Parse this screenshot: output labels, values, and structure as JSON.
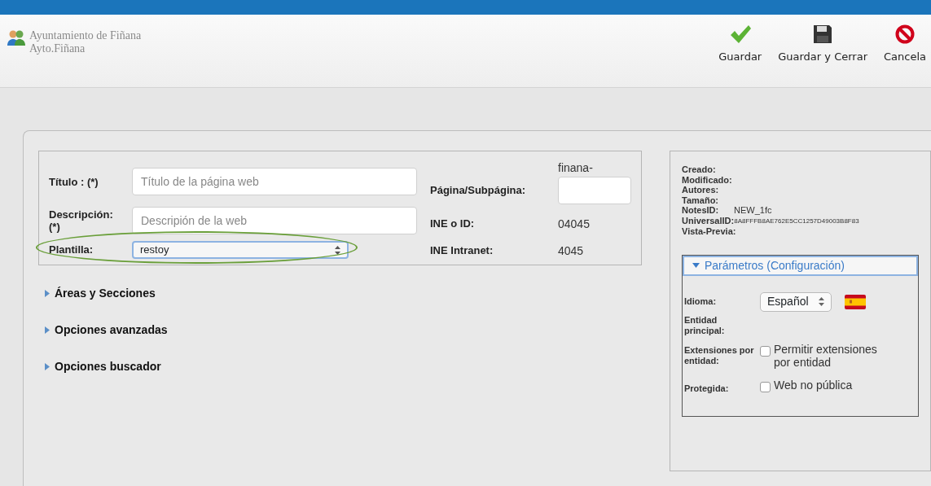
{
  "header": {
    "org_name": "Ayuntamiento de Fiñana",
    "org_short": "Ayto.Fiñana"
  },
  "toolbar": [
    {
      "kind": "save",
      "label": "Guardar"
    },
    {
      "kind": "save-close",
      "label": "Guardar y Cerrar"
    },
    {
      "kind": "cancel",
      "label": "Cancela"
    }
  ],
  "form": {
    "title_field": {
      "label": "Título : (*)",
      "placeholder": "Título de la página web"
    },
    "description_field": {
      "label": "Descripción: (*)",
      "placeholder": "Descripión de la web"
    },
    "template_field": {
      "label": "Plantilla:",
      "value": "restoy",
      "highlighted": true
    },
    "page_field": {
      "label": "Página/Subpágina:",
      "prefix": "finana-"
    },
    "ine_id": {
      "label": "INE o ID:",
      "value": "04045"
    },
    "ine_intranet": {
      "label": "INE Intranet:",
      "value": "4045"
    }
  },
  "sections": [
    {
      "label": "Áreas y Secciones",
      "expanded": false
    },
    {
      "label": "Opciones avanzadas",
      "expanded": false
    },
    {
      "label": "Opciones buscador",
      "expanded": false
    }
  ],
  "info": [
    {
      "label": "Creado:"
    },
    {
      "label": "Modificado:"
    },
    {
      "label": "Autores:"
    },
    {
      "label": "Tamaño:"
    },
    {
      "label": "NotesID:",
      "value": "NEW_1fc"
    },
    {
      "label": "UniversalID:",
      "value": "8A8FFFB8AE762E5CC1257D49003B8F83"
    },
    {
      "label": "Vista-Previa:"
    }
  ],
  "parameters": {
    "title": "Parámetros (Configuración)",
    "expanded": true,
    "language": {
      "label": "Idioma:",
      "value": "Español"
    },
    "main_entity": {
      "label": "Entidad principal:"
    },
    "extensions": {
      "label": "Extensiones por entidad:",
      "option": "Permitir extensiones por entidad",
      "checked": false
    },
    "protected": {
      "label": "Protegida:",
      "option": "Web no pública",
      "checked": false
    }
  }
}
